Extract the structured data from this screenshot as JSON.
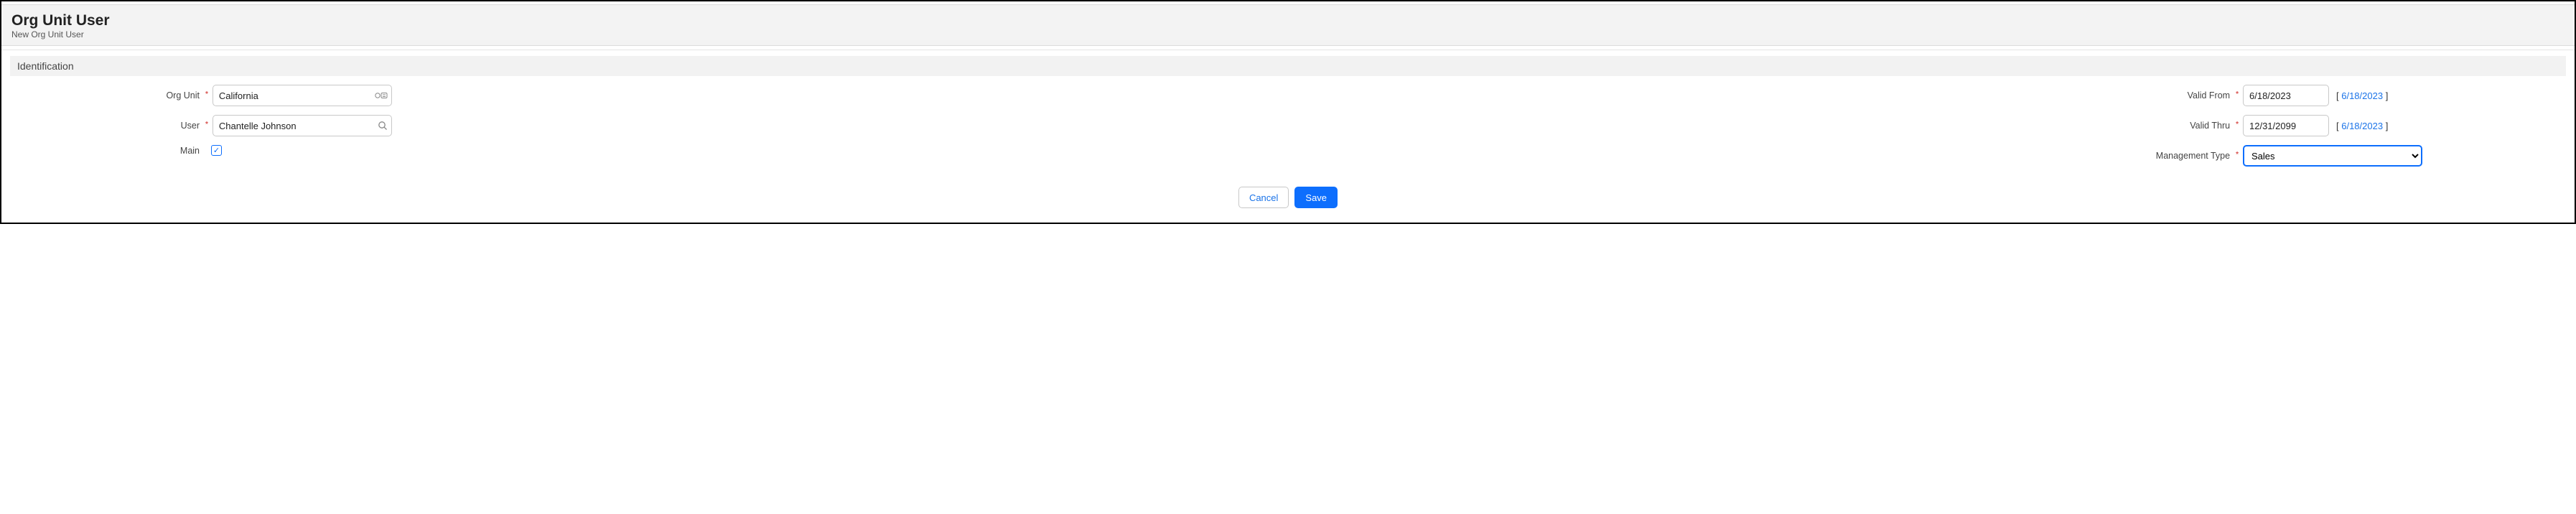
{
  "header": {
    "title": "Org Unit User",
    "subtitle": "New Org Unit User"
  },
  "section": {
    "title": "Identification"
  },
  "fields": {
    "org_unit": {
      "label": "Org Unit",
      "value": "California"
    },
    "user": {
      "label": "User",
      "value": "Chantelle Johnson"
    },
    "main": {
      "label": "Main",
      "checked": true
    },
    "valid_from": {
      "label": "Valid From",
      "value": "6/18/2023",
      "hint_date": "6/18/2023"
    },
    "valid_thru": {
      "label": "Valid Thru",
      "value": "12/31/2099",
      "hint_date": "6/18/2023"
    },
    "management_type": {
      "label": "Management Type",
      "value": "Sales"
    }
  },
  "actions": {
    "cancel": "Cancel",
    "save": "Save"
  },
  "glyphs": {
    "bracket_open": "[ ",
    "bracket_close": " ]",
    "check": "✓"
  }
}
